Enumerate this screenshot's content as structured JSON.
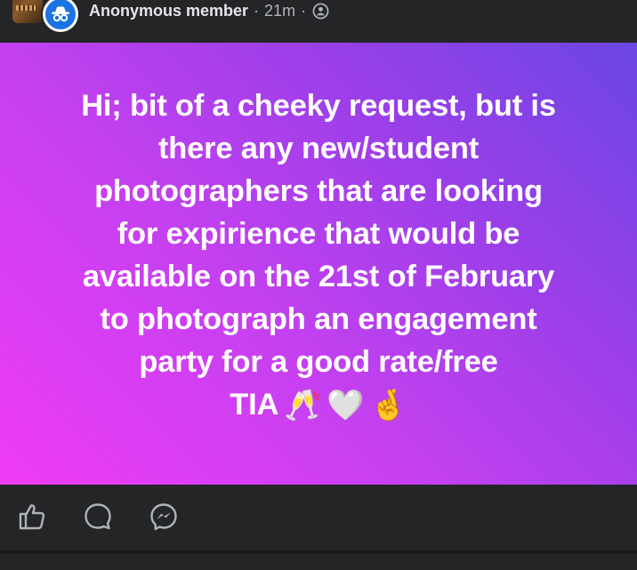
{
  "post": {
    "author": "Anonymous member",
    "separator": "·",
    "timestamp": "21m",
    "audience_icon": "privacy-group-icon",
    "group_thumbnail_icon": "group-thumbnail",
    "avatar_icon": "anonymous-incognito-icon",
    "status_lines": [
      "Hi; bit of a cheeky request, but is",
      "there any new/student",
      "photographers that are looking",
      "for expirience that would be",
      "available on the 21st of February",
      "to photograph an engagement",
      "party for a good rate/free",
      "TIA"
    ],
    "status_emojis": [
      "🥂",
      "🤍",
      "🤞"
    ],
    "background_gradient": [
      "#6b46e4",
      "#9a3fe8",
      "#c440f0",
      "#f03cf6"
    ]
  },
  "actions": {
    "like_icon": "like-thumbs-up-icon",
    "comment_icon": "comment-bubble-icon",
    "share_icon": "messenger-send-icon"
  },
  "colors": {
    "surface": "#242526",
    "text_primary": "#e4e6eb",
    "text_secondary": "#b0b3b8",
    "accent": "#1b74e4"
  }
}
